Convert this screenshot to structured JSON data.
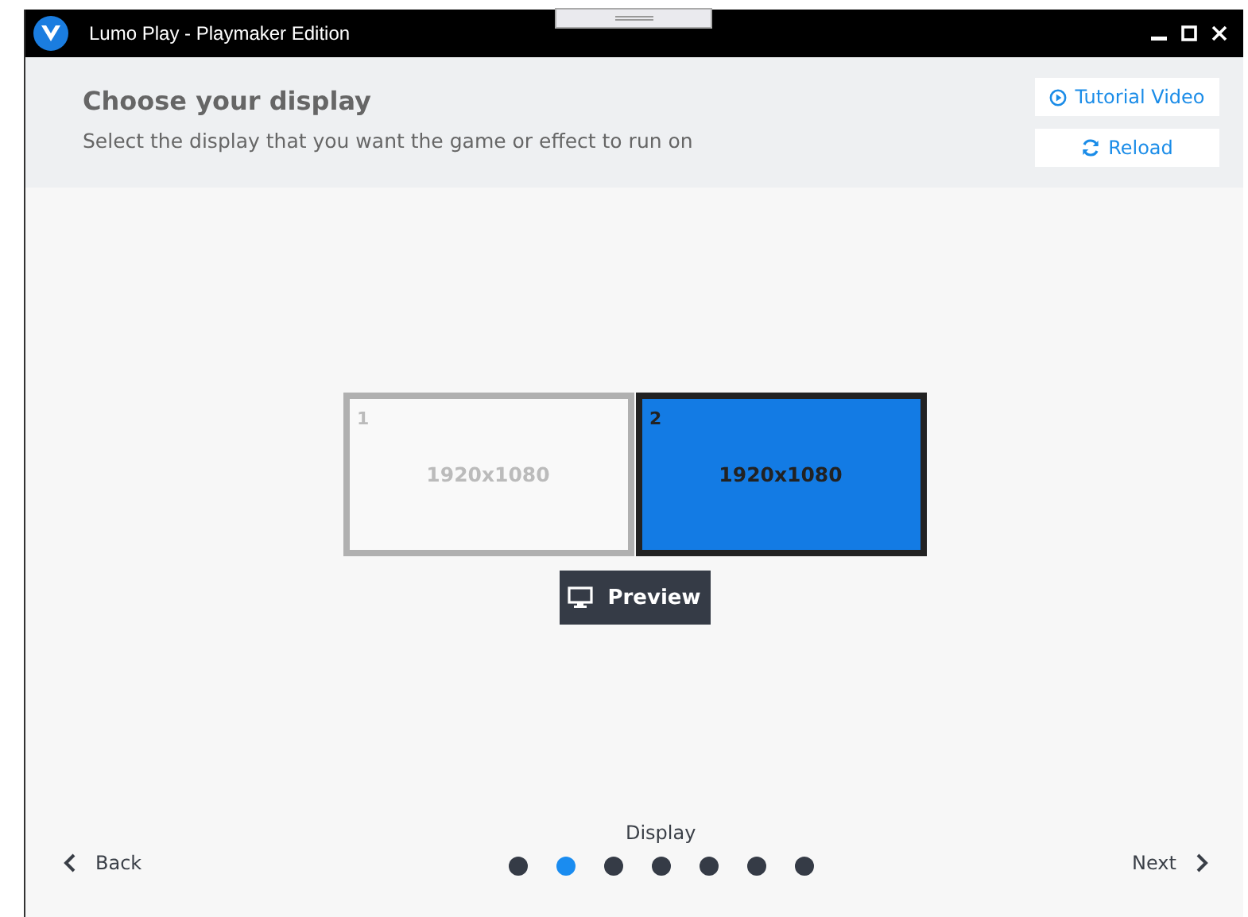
{
  "window": {
    "title": "Lumo Play - Playmaker Edition"
  },
  "header": {
    "title": "Choose your display",
    "subtitle": "Select the display that you want the game or effect to run on",
    "buttons": [
      {
        "kind": "video",
        "label": "Tutorial Video"
      },
      {
        "kind": "reload",
        "label": "Reload"
      }
    ]
  },
  "displays": [
    {
      "number": "1",
      "resolution": "1920x1080",
      "selected": false
    },
    {
      "number": "2",
      "resolution": "1920x1080",
      "selected": true
    }
  ],
  "preview_button": "Preview",
  "steps": {
    "label": "Display",
    "dots": [
      {
        "selected": false
      },
      {
        "selected": true
      },
      {
        "selected": false
      },
      {
        "selected": false
      },
      {
        "selected": false
      },
      {
        "selected": false
      },
      {
        "selected": false
      }
    ]
  },
  "nav": {
    "back": "Back",
    "next": "Next"
  }
}
